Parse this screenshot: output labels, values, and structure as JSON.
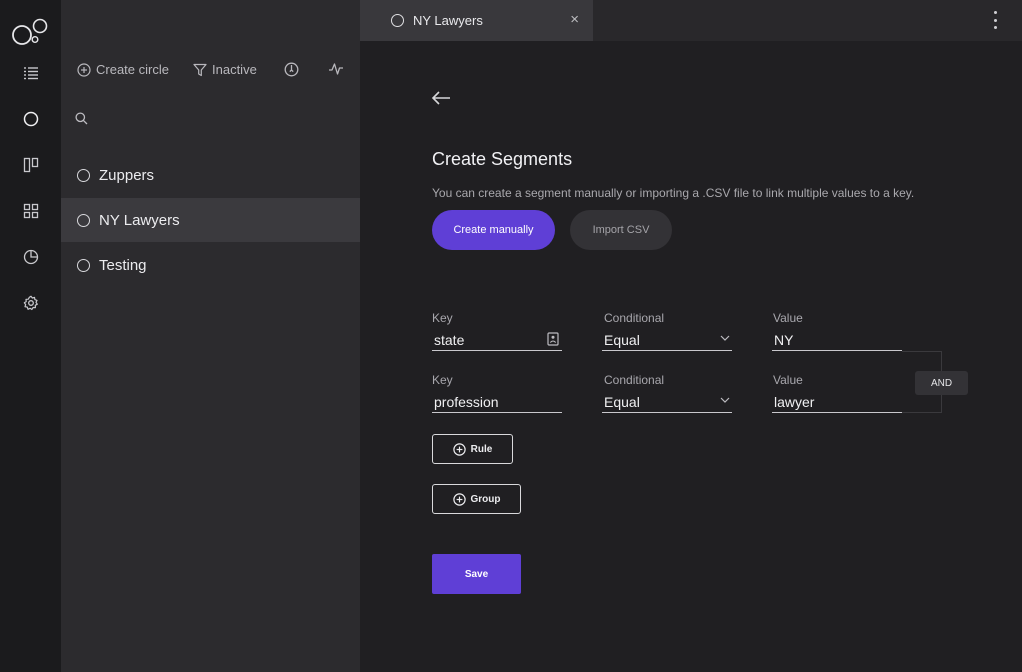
{
  "rail": {
    "items": [
      {
        "icon": "list-icon"
      },
      {
        "icon": "circle-icon"
      },
      {
        "icon": "columns-icon"
      },
      {
        "icon": "grid-icon"
      },
      {
        "icon": "pie-chart-icon"
      },
      {
        "icon": "gear-icon"
      }
    ]
  },
  "panel": {
    "toolbar": {
      "create_circle": "Create circle",
      "inactive": "Inactive"
    },
    "search": {
      "placeholder": ""
    },
    "circles": [
      {
        "label": "Zuppers",
        "active": false
      },
      {
        "label": "NY Lawyers",
        "active": true
      },
      {
        "label": "Testing",
        "active": false
      }
    ]
  },
  "tab": {
    "label": "NY Lawyers",
    "close": "×"
  },
  "segment": {
    "title": "Create Segments",
    "subtitle": "You can create a segment manually or importing a .CSV file to link multiple values to a key.",
    "create_manually": "Create manually",
    "import_csv": "Import CSV",
    "rules": [
      {
        "key_label": "Key",
        "key": "state",
        "cond_label": "Conditional",
        "cond": "Equal",
        "value_label": "Value",
        "value": "NY"
      },
      {
        "key_label": "Key",
        "key": "profession",
        "cond_label": "Conditional",
        "cond": "Equal",
        "value_label": "Value",
        "value": "lawyer"
      }
    ],
    "operator": "AND",
    "add_rule": "Rule",
    "add_group": "Group",
    "save": "Save"
  },
  "colors": {
    "accent": "#5f3fd6",
    "rail_bg": "#1b1b1d",
    "panel_bg": "#2c2b2e",
    "main_bg": "#201f22"
  }
}
